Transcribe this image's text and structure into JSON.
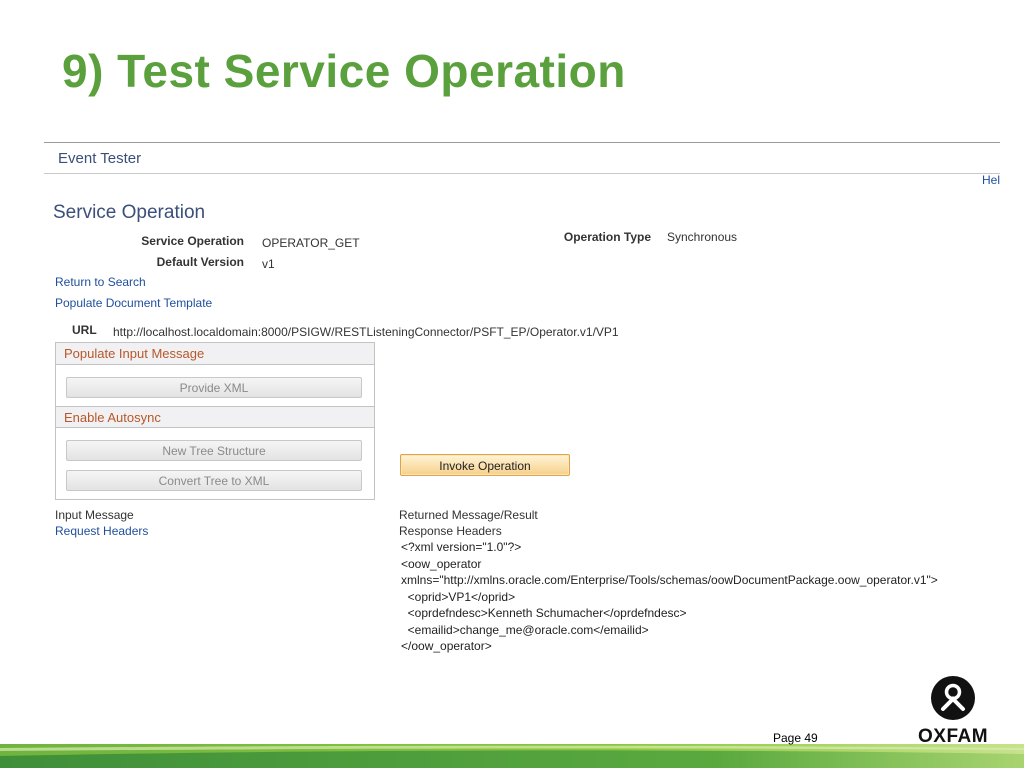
{
  "slide": {
    "title": "9) Test Service Operation",
    "page_number": "Page 49",
    "logo_text": "OXFAM"
  },
  "app": {
    "page_header": "Event Tester",
    "help_link": "Hel",
    "section_title": "Service Operation",
    "fields": {
      "service_operation_label": "Service Operation",
      "service_operation_value": "OPERATOR_GET",
      "default_version_label": "Default Version",
      "default_version_value": "v1",
      "operation_type_label": "Operation Type",
      "operation_type_value": "Synchronous",
      "url_label": "URL",
      "url_value": "http://localhost.localdomain:8000/PSIGW/RESTListeningConnector/PSFT_EP/Operator.v1/VP1"
    },
    "links": {
      "return_to_search": "Return to Search",
      "populate_document_template": "Populate Document Template",
      "request_headers": "Request Headers",
      "response_headers": "Response Headers"
    },
    "panel": {
      "populate_input_message": "Populate Input Message",
      "provide_xml": "Provide XML",
      "enable_autosync": "Enable Autosync",
      "new_tree_structure": "New Tree Structure",
      "convert_tree_to_xml": "Convert Tree to XML"
    },
    "invoke_operation": "Invoke Operation",
    "input_message_label": "Input Message",
    "returned_message_label": "Returned Message/Result",
    "xml_lines": [
      "<?xml version=\"1.0\"?>",
      "<oow_operator",
      "xmlns=\"http://xmlns.oracle.com/Enterprise/Tools/schemas/oowDocumentPackage.oow_operator.v1\">",
      "  <oprid>VP1</oprid>",
      "  <oprdefndesc>Kenneth Schumacher</oprdefndesc>",
      "  <emailid>change_me@oracle.com</emailid>",
      "</oow_operator>"
    ]
  },
  "colors": {
    "title_green": "#5aa03c",
    "header_blue": "#3a4f79",
    "link_blue": "#1f4e9c",
    "panel_head_text": "#b8572a"
  }
}
